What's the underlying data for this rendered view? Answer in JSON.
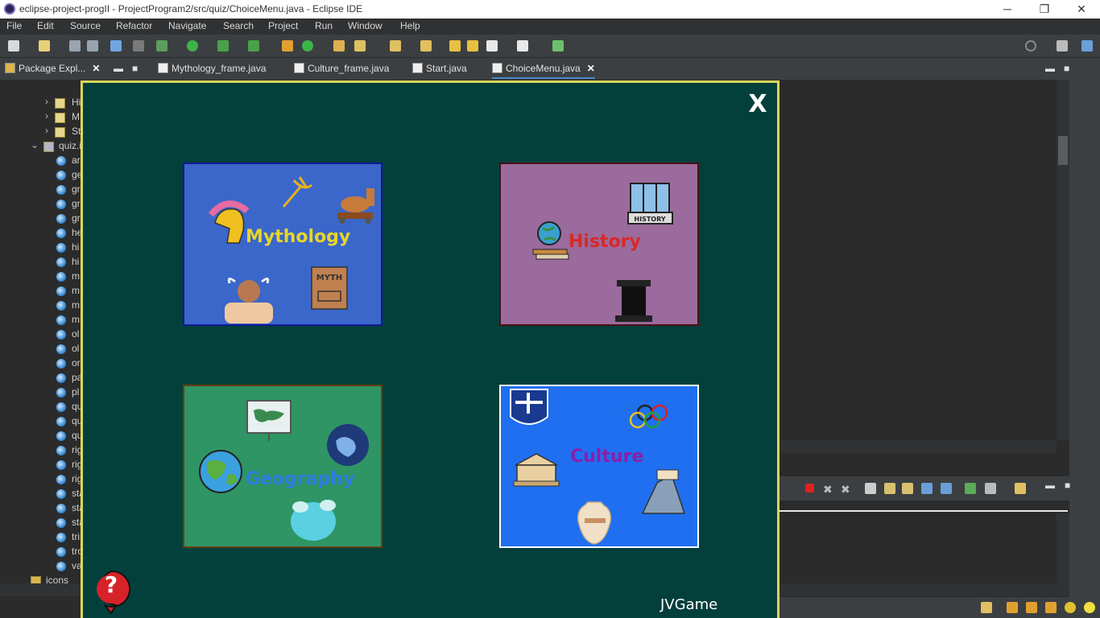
{
  "window": {
    "title": "eclipse-project-progII - ProjectProgram2/src/quiz/ChoiceMenu.java - Eclipse IDE",
    "minimize": "─",
    "restore": "❐",
    "close": "✕"
  },
  "menubar": [
    "File",
    "Edit",
    "Source",
    "Refactor",
    "Navigate",
    "Search",
    "Project",
    "Run",
    "Window",
    "Help"
  ],
  "explorer": {
    "tab_label": "Package Expl...",
    "rows": [
      "Hi",
      "M",
      "St",
      "quiz.i",
      "ar",
      "ge",
      "gr",
      "gr",
      "gr",
      "he",
      "hi",
      "hi",
      "m",
      "m",
      "m",
      "m",
      "ol",
      "ol",
      "or",
      "pa",
      "pl",
      "qu",
      "qu",
      "qu",
      "rig",
      "rig",
      "rig",
      "sta",
      "sta",
      "sta",
      "tri",
      "tro",
      "va",
      "icons"
    ]
  },
  "editor_tabs": [
    {
      "label": "Mythology_frame.java"
    },
    {
      "label": "Culture_frame.java"
    },
    {
      "label": "Start.java"
    },
    {
      "label": "ChoiceMenu.java",
      "active": true
    }
  ],
  "game": {
    "close_label": "X",
    "help_label": "?",
    "footer": "JVGame",
    "categories": {
      "mythology": {
        "label": "Mythology",
        "bg": "#3a67c9",
        "border": "#10189a",
        "label_color": "#e8d52a"
      },
      "history": {
        "label": "History",
        "bg": "#9a6b9c",
        "border": "#4a0f18",
        "label_color": "#d8282a"
      },
      "geography": {
        "label": "Geography",
        "bg": "#2f9565",
        "border": "#6b3d10",
        "label_color": "#2f7be0"
      },
      "culture": {
        "label": "Culture",
        "bg": "#1f6ff0",
        "border": "#ffffff",
        "label_color": "#8a1fa8"
      }
    },
    "history_book_text": "HISTORY",
    "myth_book_text": "MYTH"
  },
  "colors": {
    "game_bg": "#03403c",
    "game_border": "#d9d75a",
    "ide_dark": "#2b2b2b",
    "ide_panel": "#3c3f41"
  }
}
